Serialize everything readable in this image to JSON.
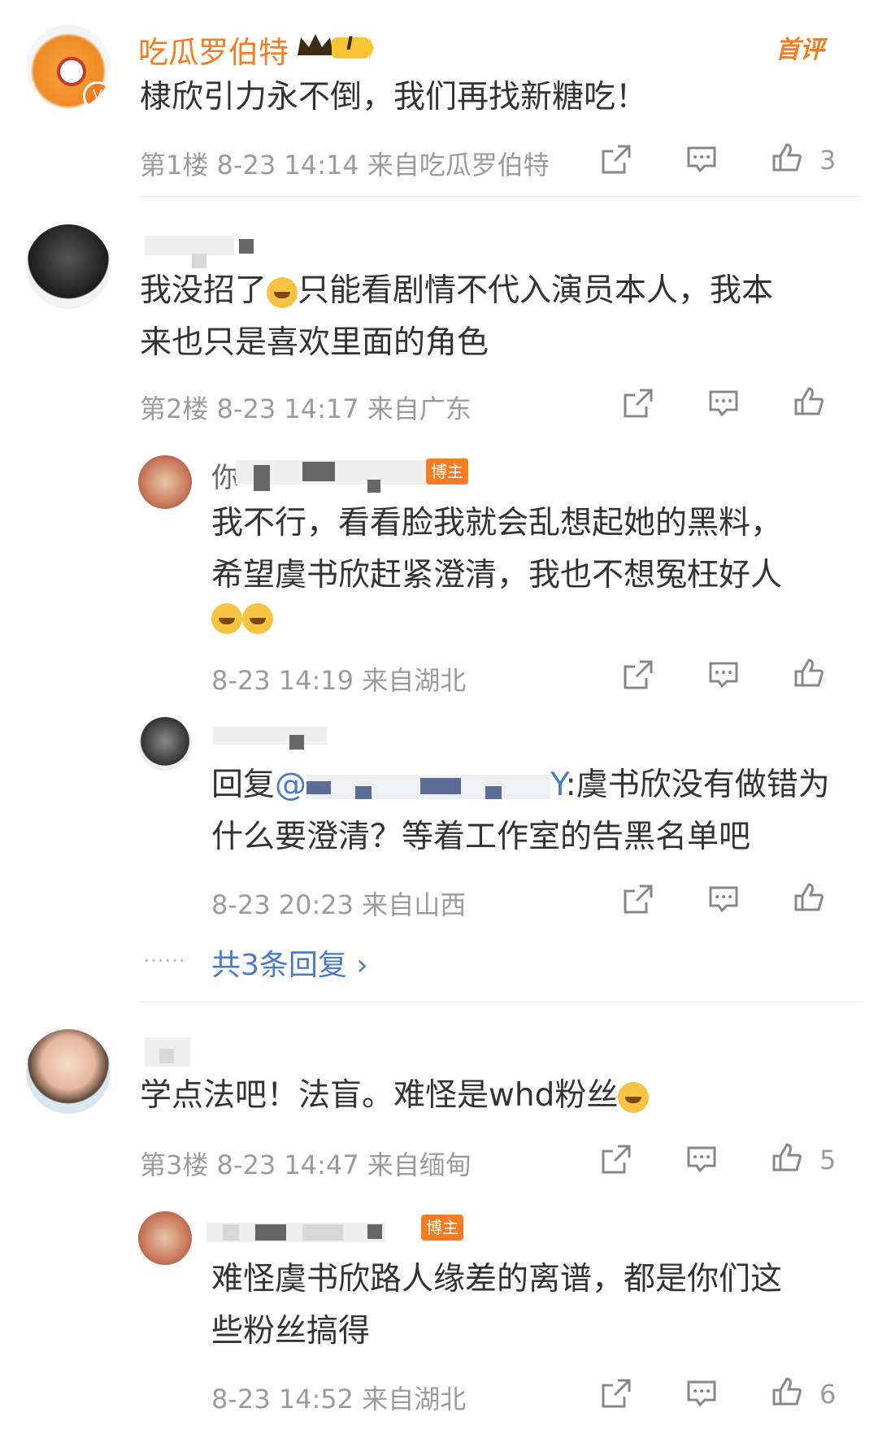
{
  "comments": [
    {
      "username": "吃瓜罗伯特",
      "level": "I",
      "tag": "首评",
      "text": "棣欣引力永不倒，我们再找新糖吃！",
      "floor": "第1楼",
      "time": "8-23 14:14",
      "source": "来自吃瓜罗伯特",
      "likes": "3"
    },
    {
      "text_line1": "我没招了",
      "text_line1b": "只能看剧情不代入演员本人，我本",
      "text_line2": "来也只是喜欢里面的角色",
      "floor": "第2楼",
      "time": "8-23 14:17",
      "source": "来自广东",
      "replies": [
        {
          "name_prefix": "你",
          "badge": "博主",
          "text_line1": "我不行，看看脸我就会乱想起她的黑料，",
          "text_line2": "希望虞书欣赶紧澄清，我也不想冤枉好人",
          "time": "8-23 14:19",
          "source": "来自湖北"
        },
        {
          "reply_prefix": "回复",
          "mention": "@",
          "mention_tail": "Y",
          "text_line1": ":虞书欣没有做错为",
          "text_line2": "什么要澄清？等着工作室的告黑名单吧",
          "time": "8-23 20:23",
          "source": "来自山西"
        }
      ],
      "more_dots": "……",
      "more_replies": "共3条回复 ›"
    },
    {
      "text": "学点法吧！法盲。难怪是whd粉丝",
      "floor": "第3楼",
      "time": "8-23 14:47",
      "source": "来自缅甸",
      "likes": "5",
      "replies": [
        {
          "badge": "博主",
          "text_line1": "难怪虞书欣路人缘差的离谱，都是你们这",
          "text_line2": "些粉丝搞得",
          "time": "8-23 14:52",
          "source": "来自湖北",
          "likes": "6"
        }
      ]
    }
  ],
  "icons": {
    "share": "share-icon",
    "comment": "comment-icon",
    "like": "like-icon"
  },
  "colors": {
    "accent": "#f57c22",
    "link": "#4a7bc7",
    "meta": "#9b9b9b"
  }
}
